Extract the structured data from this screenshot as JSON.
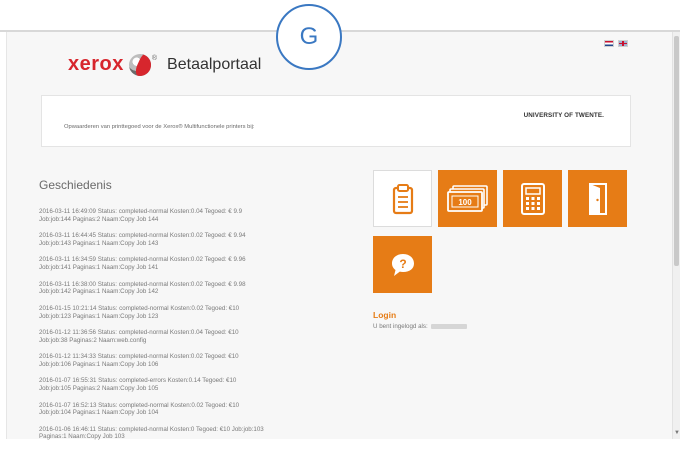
{
  "overlay": {
    "marker": "G"
  },
  "header": {
    "brand": "xerox",
    "brand_mark": "®",
    "title": "Betaalportaal",
    "languages": [
      "nl",
      "en"
    ]
  },
  "info": {
    "text": "Opwaarderen van printtegoed voor de Xerox® Multifunctionele printers bij:",
    "institution": "UNIVERSITY OF TWENTE."
  },
  "history": {
    "title": "Geschiedenis",
    "items": [
      {
        "line1": "2016-03-11 16:49:09 Status: completed-normal Kosten:0.04 Tegoed: € 9.9",
        "line2": "Job:job:144 Paginas:2 Naam:Copy Job 144"
      },
      {
        "line1": "2016-03-11 16:44:45 Status: completed-normal Kosten:0.02 Tegoed: € 9.94",
        "line2": "Job:job:143 Paginas:1 Naam:Copy Job 143"
      },
      {
        "line1": "2016-03-11 16:34:59 Status: completed-normal Kosten:0.02 Tegoed: € 9.96",
        "line2": "Job:job:141 Paginas:1 Naam:Copy Job 141"
      },
      {
        "line1": "2016-03-11 16:38:00 Status: completed-normal Kosten:0.02 Tegoed: € 9.98",
        "line2": "Job:job:142 Paginas:1 Naam:Copy Job 142"
      },
      {
        "line1": "2016-01-15 10:21:14 Status: completed-normal Kosten:0.02 Tegoed: €10",
        "line2": "Job:job:123 Paginas:1 Naam:Copy Job 123"
      },
      {
        "line1": "2016-01-12 11:36:56 Status: completed-normal Kosten:0.04 Tegoed: €10",
        "line2": "Job:job:38 Paginas:2 Naam:web.config"
      },
      {
        "line1": "2016-01-12 11:34:33 Status: completed-normal Kosten:0.02 Tegoed: €10",
        "line2": "Job:job:106 Paginas:1 Naam:Copy Job 106"
      },
      {
        "line1": "2016-01-07 16:55:31 Status: completed-errors Kosten:0.14 Tegoed: €10",
        "line2": "Job:job:105 Paginas:2 Naam:Copy Job 105"
      },
      {
        "line1": "2016-01-07 16:52:13 Status: completed-normal Kosten:0.02 Tegoed: €10",
        "line2": "Job:job:104 Paginas:1 Naam:Copy Job 104"
      },
      {
        "line1": "2016-01-06 16:46:11 Status: completed-normal Kosten:0 Tegoed: €10   Job:job:103",
        "line2": "Paginas:1 Naam:Copy Job 103"
      }
    ]
  },
  "tiles": [
    {
      "name": "history-tile",
      "icon": "clipboard-icon",
      "style": "white"
    },
    {
      "name": "topup-tile",
      "icon": "banknotes-icon",
      "style": "orange"
    },
    {
      "name": "calculator-tile",
      "icon": "calculator-icon",
      "style": "orange"
    },
    {
      "name": "logout-tile",
      "icon": "door-exit-icon",
      "style": "orange"
    },
    {
      "name": "help-tile",
      "icon": "help-bubble-icon",
      "style": "orange"
    }
  ],
  "login": {
    "label": "Login",
    "status": "U bent ingelogd als:"
  },
  "colors": {
    "accent": "#e67c16",
    "brand_red": "#d7262d",
    "marker_blue": "#3a78c2"
  }
}
